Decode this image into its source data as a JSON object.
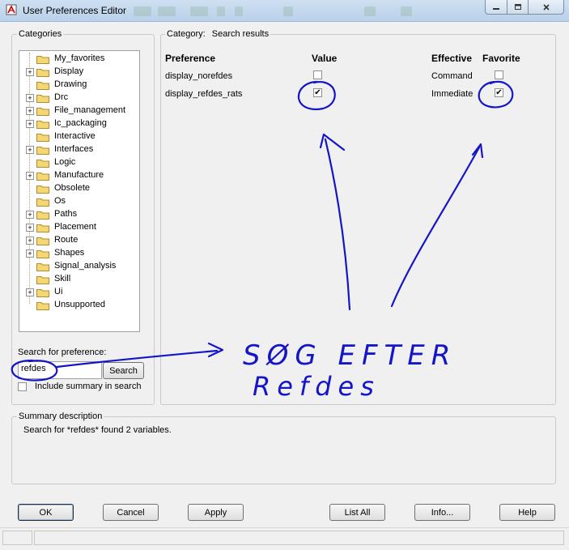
{
  "window": {
    "title": "User Preferences Editor"
  },
  "categories": {
    "legend": "Categories",
    "items": [
      {
        "label": "My_favorites",
        "expandable": false
      },
      {
        "label": "Display",
        "expandable": true
      },
      {
        "label": "Drawing",
        "expandable": false
      },
      {
        "label": "Drc",
        "expandable": true
      },
      {
        "label": "File_management",
        "expandable": true
      },
      {
        "label": "Ic_packaging",
        "expandable": true
      },
      {
        "label": "Interactive",
        "expandable": false
      },
      {
        "label": "Interfaces",
        "expandable": true
      },
      {
        "label": "Logic",
        "expandable": false
      },
      {
        "label": "Manufacture",
        "expandable": true
      },
      {
        "label": "Obsolete",
        "expandable": false
      },
      {
        "label": "Os",
        "expandable": false
      },
      {
        "label": "Paths",
        "expandable": true
      },
      {
        "label": "Placement",
        "expandable": true
      },
      {
        "label": "Route",
        "expandable": true
      },
      {
        "label": "Shapes",
        "expandable": true
      },
      {
        "label": "Signal_analysis",
        "expandable": false
      },
      {
        "label": "Skill",
        "expandable": false
      },
      {
        "label": "Ui",
        "expandable": true
      },
      {
        "label": "Unsupported",
        "expandable": false
      }
    ]
  },
  "search": {
    "label": "Search for preference:",
    "value": "refdes",
    "button": "Search",
    "include_summary_label": "Include summary in search",
    "include_summary_checked": false
  },
  "category_panel": {
    "legend_prefix": "Category:",
    "legend_value": "Search results",
    "headers": {
      "preference": "Preference",
      "value": "Value",
      "effective": "Effective",
      "favorite": "Favorite"
    },
    "rows": [
      {
        "preference": "display_norefdes",
        "value_checked": false,
        "effective": "Command",
        "favorite_checked": false
      },
      {
        "preference": "display_refdes_rats",
        "value_checked": true,
        "effective": "Immediate",
        "favorite_checked": true
      }
    ]
  },
  "summary": {
    "legend": "Summary description",
    "text": "Search for *refdes* found 2 variables."
  },
  "buttons": {
    "ok": "OK",
    "cancel": "Cancel",
    "apply": "Apply",
    "list_all": "List All",
    "info": "Info...",
    "help": "Help"
  },
  "annotation": {
    "line1": "SØG EFTER",
    "line2": "Refdes",
    "color": "#1515c8"
  },
  "icons": {
    "app": "app-icon",
    "folder": "folder-icon",
    "expander": "plus-icon",
    "minimize": "minimize-icon",
    "maximize": "maximize-icon",
    "close": "close-icon"
  }
}
